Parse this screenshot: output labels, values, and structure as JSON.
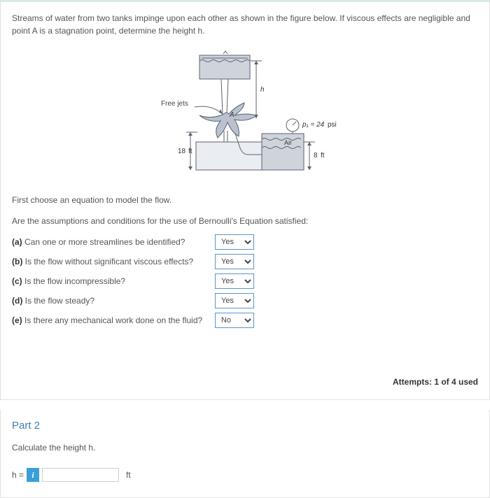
{
  "problem": {
    "text": "Streams of water from two tanks impinge upon each other as shown in the figure below. If viscous effects are negligible and point A is a stagnation point, determine the height h."
  },
  "figure": {
    "free_jets_label": "Free jets",
    "h_label": "h",
    "point_a_label": "A",
    "left_height_value": "18",
    "left_height_unit": "ft",
    "right_height_value": "8",
    "right_height_unit": "ft",
    "air_label": "Air",
    "pressure_label": "p₁ = 24",
    "pressure_unit": "psi"
  },
  "instructions": {
    "choose": "First choose an equation to model the flow.",
    "assumptions": "Are the assumptions and conditions for the use of Bernoulli's Equation satisfied:"
  },
  "conditions": [
    {
      "tag": "(a)",
      "text": "Can one or more streamlines be identified?",
      "value": "Yes"
    },
    {
      "tag": "(b)",
      "text": "Is the flow without significant viscous effects?",
      "value": "Yes"
    },
    {
      "tag": "(c)",
      "text": "Is the flow incompressible?",
      "value": "Yes"
    },
    {
      "tag": "(d)",
      "text": "Is the flow steady?",
      "value": "Yes"
    },
    {
      "tag": "(e)",
      "text": "Is there any mechanical work done on the fluid?",
      "value": "No"
    }
  ],
  "select_options": [
    "Yes",
    "No"
  ],
  "attempts": "Attempts: 1 of 4 used",
  "part2": {
    "title": "Part 2",
    "prompt": "Calculate the height h.",
    "var": "h =",
    "unit": "ft",
    "value": ""
  }
}
